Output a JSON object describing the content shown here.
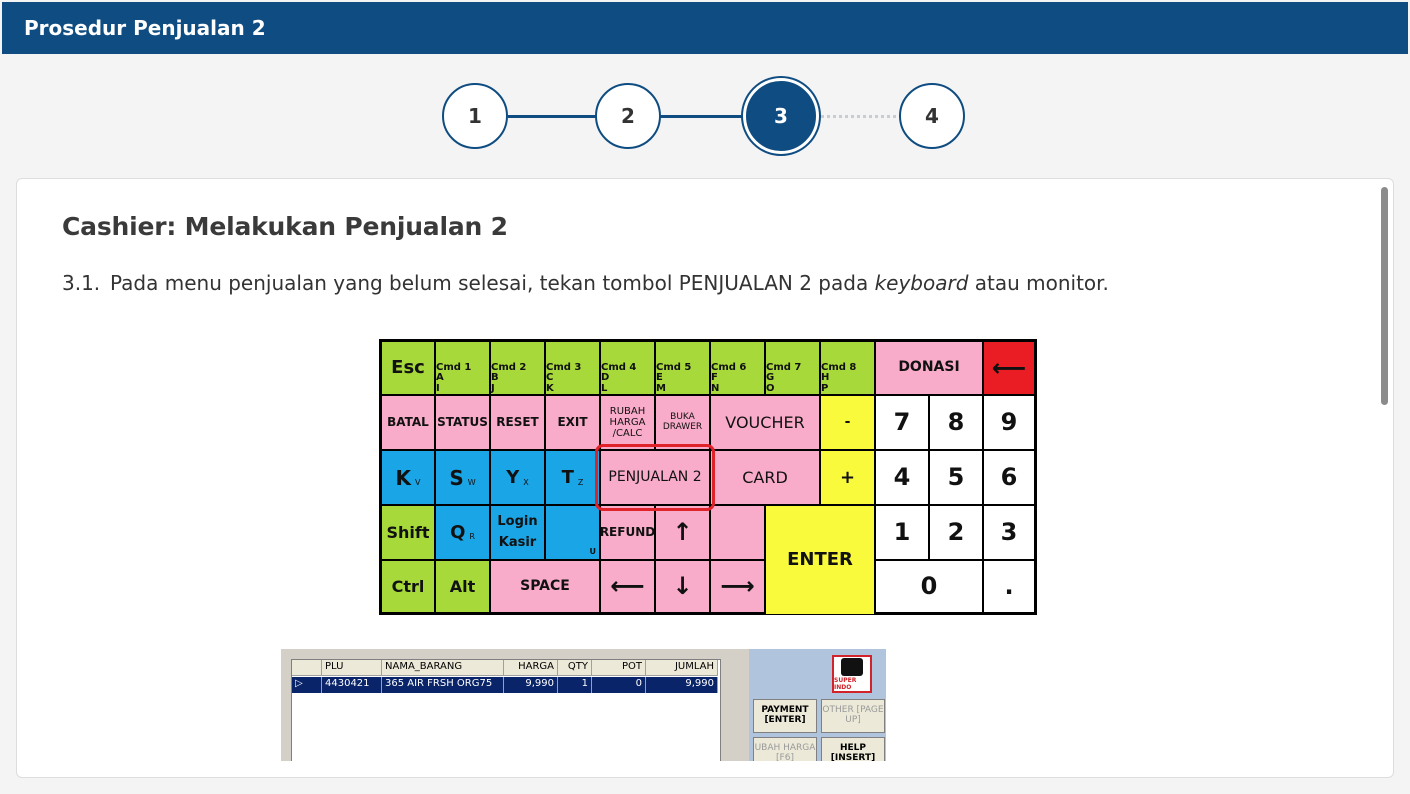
{
  "window": {
    "title": "Prosedur Penjualan 2"
  },
  "stepper": {
    "steps": [
      "1",
      "2",
      "3",
      "4"
    ],
    "active_step": 3
  },
  "content": {
    "heading": "Cashier: Melakukan Penjualan 2",
    "instruction": {
      "number": "3.1.",
      "text_before": "Pada menu penjualan yang belum selesai, tekan tombol ",
      "bold": "PENJUALAN 2",
      "text_mid": " pada ",
      "italic": "keyboard",
      "text_after": " atau monitor."
    }
  },
  "keyboard": {
    "row1": {
      "esc": "Esc",
      "cmd1": {
        "a": "Cmd  1",
        "b": "A",
        "c": "I"
      },
      "cmd2": {
        "a": "Cmd  2",
        "b": "B",
        "c": "J"
      },
      "cmd3": {
        "a": "Cmd  3",
        "b": "C",
        "c": "K"
      },
      "cmd4": {
        "a": "Cmd  4",
        "b": "D",
        "c": "L"
      },
      "cmd5": {
        "a": "Cmd  5",
        "b": "E",
        "c": "M"
      },
      "cmd6": {
        "a": "Cmd  6",
        "b": "F",
        "c": "N"
      },
      "cmd7": {
        "a": "Cmd  7",
        "b": "G",
        "c": "O"
      },
      "cmd8": {
        "a": "Cmd  8",
        "b": "H",
        "c": "P"
      },
      "donasi": "DONASI",
      "backspace": "⟵"
    },
    "row2": {
      "batal": "BATAL",
      "status": "STATUS",
      "reset": "RESET",
      "exit": "EXIT",
      "rubah": "RUBAH HARGA /CALC",
      "buka": "BUKA DRAWER",
      "voucher": "VOUCHER",
      "minus": "-",
      "n7": "7",
      "n8": "8",
      "n9": "9"
    },
    "row3": {
      "k": "K",
      "k_sub": "V",
      "s": "S",
      "s_sub": "W",
      "y": "Y",
      "y_sub": "X",
      "t": "T",
      "t_sub": "Z",
      "penjualan2": "PENJUALAN 2",
      "card": "CARD",
      "plus": "+",
      "n4": "4",
      "n5": "5",
      "n6": "6"
    },
    "row4": {
      "shift": "Shift",
      "q": "Q",
      "q_sub": "R",
      "login": "Login Kasir",
      "u_sub": "U",
      "refund": "REFUND",
      "up": "↑",
      "enter": "ENTER",
      "n1": "1",
      "n2": "2",
      "n3": "3"
    },
    "row5": {
      "ctrl": "Ctrl",
      "alt": "Alt",
      "space": "SPACE",
      "left": "⟵",
      "down": "↓",
      "right": "⟶",
      "n0": "0",
      "dot": "."
    }
  },
  "pos_screen": {
    "columns": [
      "",
      "PLU",
      "NAMA_BARANG",
      "HARGA",
      "QTY",
      "POT",
      "JUMLAH"
    ],
    "rows": [
      [
        "▷",
        "4430421",
        "365 AIR FRSH ORG75",
        "9,990",
        "1",
        "0",
        "9,990"
      ]
    ],
    "logo_text": "SUPER INDO",
    "buttons": {
      "payment": "PAYMENT [ENTER]",
      "other": "OTHER [PAGE UP]",
      "ubah": "UBAH HARGA [F6]",
      "help": "HELP [INSERT]"
    }
  },
  "colors": {
    "brand": "#0f4c81",
    "key_green": "#a7d93a",
    "key_pink": "#f9acc9",
    "key_blue": "#1aa5e6",
    "key_yellow": "#fafa3c",
    "key_red": "#ea1c24",
    "highlight": "#e0232a"
  }
}
